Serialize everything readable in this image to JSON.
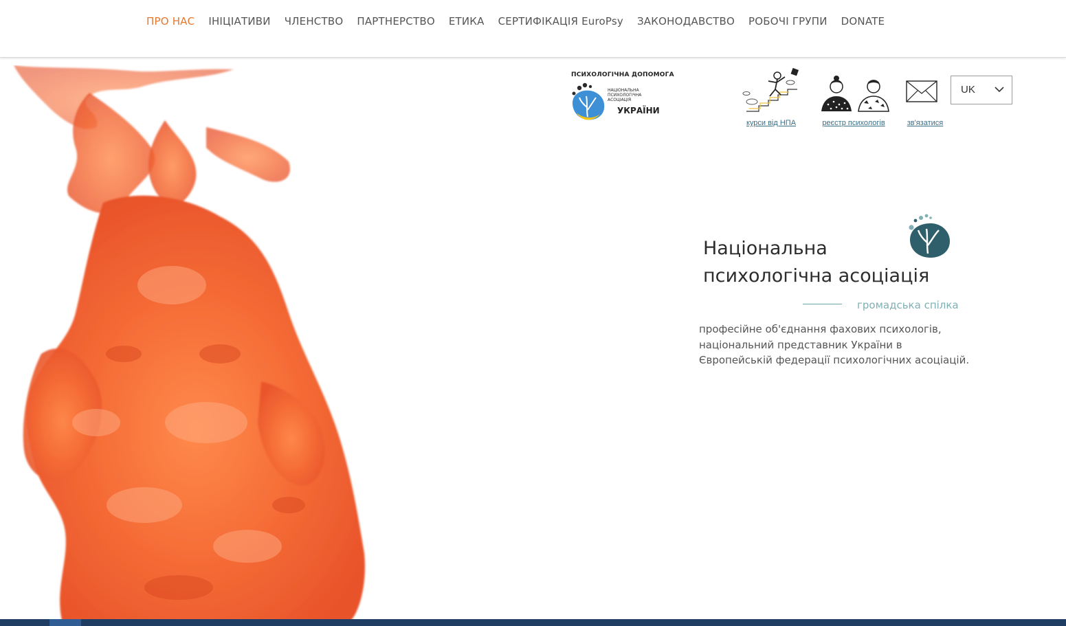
{
  "nav": {
    "items": [
      {
        "label": "ПРО НАС",
        "active": true
      },
      {
        "label": "ІНІЦІАТИВИ",
        "active": false
      },
      {
        "label": "ЧЛЕНСТВО",
        "active": false
      },
      {
        "label": "ПАРТНЕРСТВО",
        "active": false
      },
      {
        "label": "ЕТИКА",
        "active": false
      },
      {
        "label": "СЕРТИФІКАЦІЯ EuroPsy",
        "active": false
      },
      {
        "label": "ЗАКОНОДАВСТВО",
        "active": false
      },
      {
        "label": "РОБОЧІ ГРУПИ",
        "active": false
      },
      {
        "label": "DONATE",
        "active": false
      }
    ],
    "active_color": "#e8772e"
  },
  "help_logo": {
    "caption": "ПСИХОЛОГІЧНА ДОПОМОГА",
    "org_line1": "НАЦІОНАЛЬНА",
    "org_line2": "ПСИХОЛОГІЧНА",
    "org_line3": "АСОЦІАЦІЯ",
    "org_big": "УКРАЇНИ"
  },
  "quick_links": {
    "courses": {
      "label": "курси від НПА ",
      "icon": "climbing-student-icon"
    },
    "registry": {
      "label": "реєстр психологів",
      "icon": "psychologists-people-icon"
    },
    "contact": {
      "label": "зв'язатися ",
      "icon": "envelope-icon"
    }
  },
  "language": {
    "selected": "UK"
  },
  "association": {
    "title_line1": "Національна",
    "title_line2": "психологічна асоціація",
    "subtitle": "громадська спілка",
    "desc_line1": "професійне об'єднання фахових психологів,",
    "desc_line2": "національний представник України в",
    "desc_line3": "Європейській федерації психологічних асоціацій.",
    "brand_color": "#2e5f6b"
  }
}
